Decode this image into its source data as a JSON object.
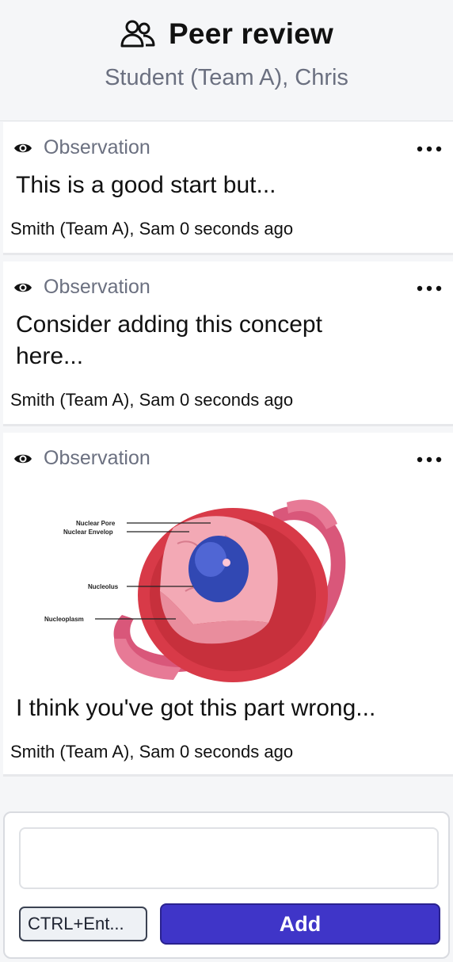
{
  "header": {
    "title": "Peer review",
    "subtitle": "Student (Team A), Chris",
    "icon": "users-icon"
  },
  "cards": [
    {
      "type_label": "Observation",
      "text": "This is a good start but...",
      "meta": "Smith (Team A), Sam 0 seconds ago"
    },
    {
      "type_label": "Observation",
      "text_line1": "Consider adding this concept",
      "text_line2": "here...",
      "meta": "Smith (Team A), Sam 0 seconds ago"
    },
    {
      "type_label": "Observation",
      "image_labels": [
        "Nuclear Pore",
        "Nuclear Envelop",
        "Nucleolus",
        "Nucleoplasm"
      ],
      "text": "I think you've got this part wrong...",
      "meta": "Smith (Team A), Sam 0 seconds ago"
    }
  ],
  "composer": {
    "input_value": "",
    "shortcut_label": "CTRL+Ent...",
    "add_label": "Add"
  },
  "colors": {
    "accent": "#3f35c8",
    "muted_text": "#6b7080",
    "background": "#f5f6f8"
  }
}
